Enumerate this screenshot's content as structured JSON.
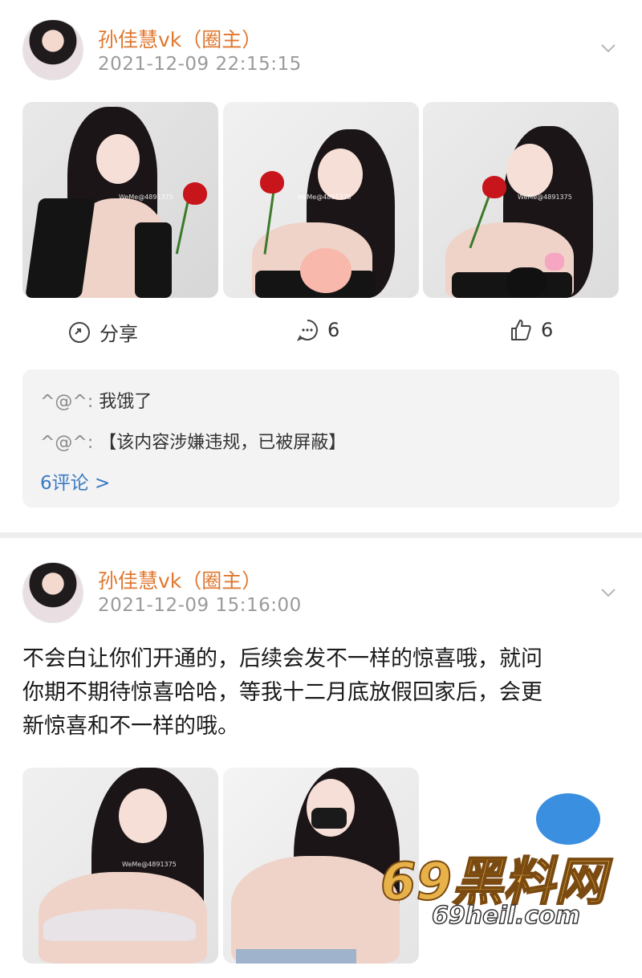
{
  "posts": [
    {
      "author": "孙佳慧vk（圈主）",
      "time": "2021-12-09 22:15:15",
      "photos": [
        {
          "watermark": "WeMe@4891375"
        },
        {
          "watermark": "WeMe@4891375"
        },
        {
          "watermark": "WeMe@4891375"
        }
      ],
      "actions": {
        "share": "分享",
        "comments": "6",
        "likes": "6"
      },
      "comment_list": [
        {
          "user": "^@^:",
          "text": "我饿了"
        },
        {
          "user": "^@^:",
          "text": "【该内容涉嫌违规，已被屏蔽】"
        }
      ],
      "more_comments": "6评论 >"
    },
    {
      "author": "孙佳慧vk（圈主）",
      "time": "2021-12-09 15:16:00",
      "text_lines": [
        "不会白让你们开通的，后续会发不一样的惊喜哦，就问",
        "你期不期待惊喜哈哈，等我十二月底放假回家后，会更",
        "新惊喜和不一样的哦。"
      ],
      "photos": [
        {
          "watermark": "WeMe@4891375"
        }
      ]
    }
  ],
  "site_watermark": {
    "big": "69黑料网",
    "small": "69heil.com"
  },
  "colors": {
    "name": "#e0772e",
    "link": "#3a79c4",
    "time": "#9a9a9a"
  }
}
